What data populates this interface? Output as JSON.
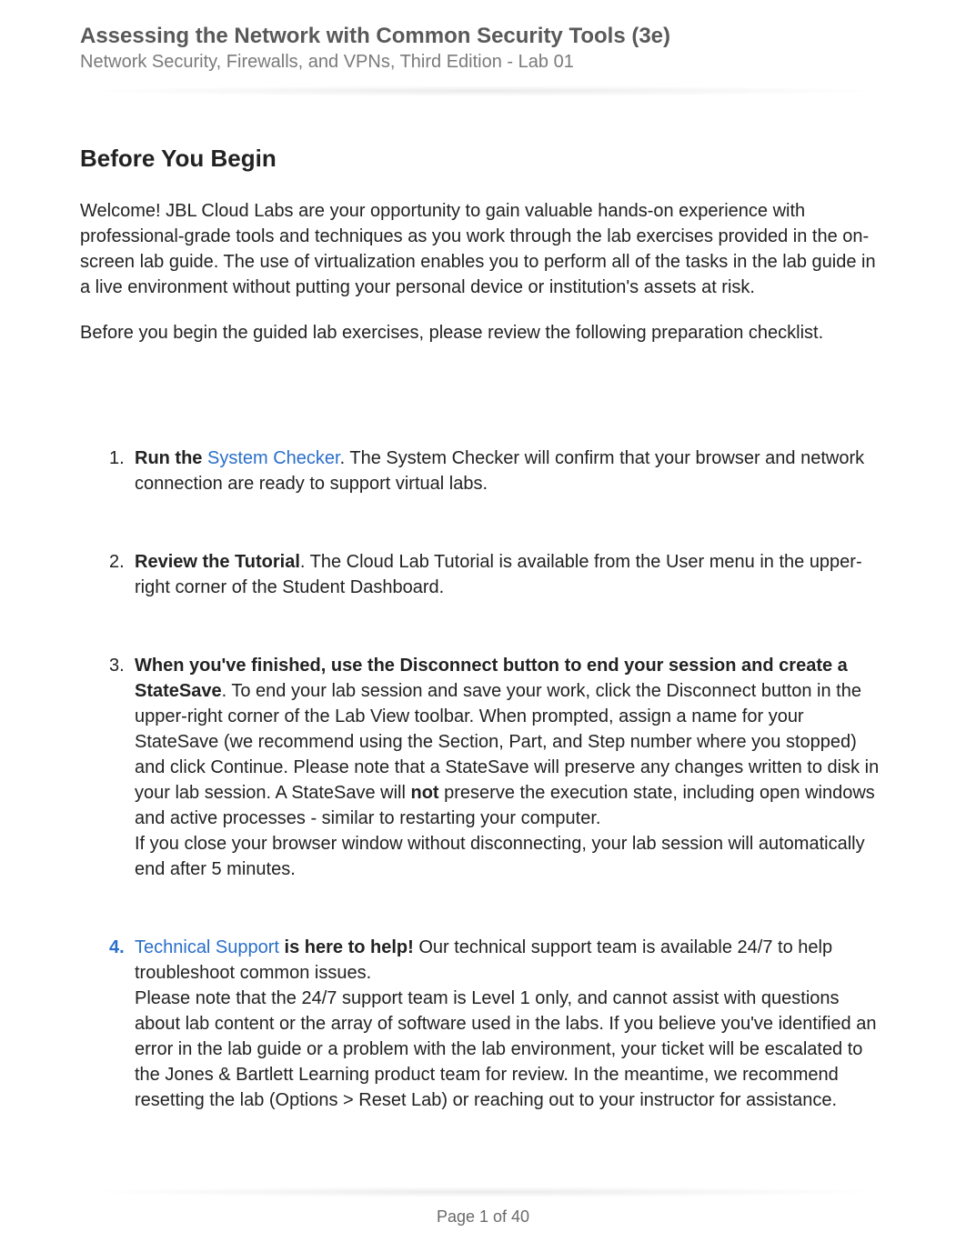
{
  "header": {
    "title": "Assessing the Network with Common Security Tools (3e)",
    "subtitle": "Network Security, Firewalls, and VPNs, Third Edition - Lab 01"
  },
  "section": {
    "heading": "Before You Begin",
    "intro1": "Welcome! JBL Cloud Labs are your opportunity to gain valuable hands-on experience with professional-grade tools and techniques as you work through the lab exercises provided in the on-screen lab guide. The use of virtualization enables you to perform all of the tasks in the lab guide in a live environment without putting your personal device or institution's assets at risk.",
    "intro2": "Before you begin the guided lab exercises, please review the following preparation checklist."
  },
  "checklist": {
    "item1": {
      "num": "1.",
      "bold_prefix": "Run the ",
      "link_text": "System Checker",
      "rest": ". The System Checker will confirm that your browser and network connection are ready to support virtual labs."
    },
    "item2": {
      "num": "2.",
      "bold_prefix": "Review the Tutorial",
      "rest": ". The Cloud Lab Tutorial is available from the User menu in the upper-right corner of the Student Dashboard."
    },
    "item3": {
      "num": "3.",
      "bold_prefix": "When you've finished, use the Disconnect button to end your session and create a StateSave",
      "rest1": ". To end your lab session and save your work, click the Disconnect button in the upper-right corner of the Lab View toolbar. When prompted, assign a name for your StateSave (we recommend using the Section, Part, and Step number where you stopped) and click Continue. Please note that a StateSave will preserve any changes written to disk in your lab session. A StateSave will ",
      "bold_not": "not",
      "rest2": " preserve the execution state, including open windows and active processes - similar to restarting your computer.",
      "rest3": "If you close your browser window without disconnecting, your lab session will automatically end after 5 minutes."
    },
    "item4": {
      "num": "4.",
      "link_text": "Technical Support",
      "bold_mid": " is here to help!",
      "rest1": " Our technical support team is available 24/7 to help troubleshoot common issues.",
      "rest2": "Please note that the 24/7 support team is Level 1 only, and cannot assist with questions about lab content or the array of software used in the labs. If you believe you've identified an error in the lab guide or a problem with the lab environment, your ticket will be escalated to the Jones & Bartlett Learning product team for review. In the meantime, we recommend resetting the lab (Options > Reset Lab) or reaching out to your instructor for assistance."
    }
  },
  "footer": {
    "page_label": "Page 1 of 40"
  }
}
